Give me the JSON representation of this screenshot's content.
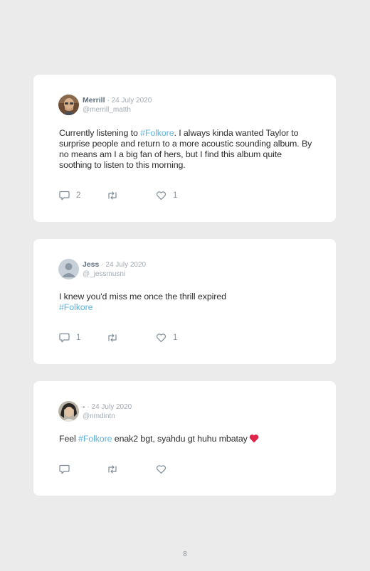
{
  "tweets": [
    {
      "name": "Merrill",
      "date": "· 24 July 2020",
      "handle": "@merrill_matth",
      "text_before": "Currently listening to ",
      "hashtag": "#Folkore",
      "text_after": ". I always kinda wanted Taylor to surprise people and return to a more acoustic sounding album. By no means am I a big fan of hers, but I find this album quite soothing to listen to this morning.",
      "replies": "2",
      "retweets": "",
      "likes": "1"
    },
    {
      "name": "Jess",
      "date": "· 24 July 2020",
      "handle": "@_jessmusni",
      "text_before": "I knew you'd miss me once the thrill expired",
      "hashtag": "#Folkore",
      "text_after": "",
      "replies": "1",
      "retweets": "",
      "likes": "1"
    },
    {
      "name": "-",
      "date": "· 24 July 2020",
      "handle": "@nmdintn",
      "text_before": "Feel ",
      "hashtag": "#Folkore",
      "text_after": " enak2 bgt, syahdu gt huhu mbatay",
      "replies": "",
      "retweets": "",
      "likes": ""
    }
  ],
  "page_number": "8",
  "colors": {
    "background": "#ebebeb",
    "card": "#ffffff",
    "hashtag": "#5fb2dc",
    "heart_emoji": "#e0264a"
  },
  "icons": {
    "reply": "reply-icon",
    "retweet": "retweet-icon",
    "like": "heart-icon",
    "emoji": "red-heart-emoji"
  }
}
